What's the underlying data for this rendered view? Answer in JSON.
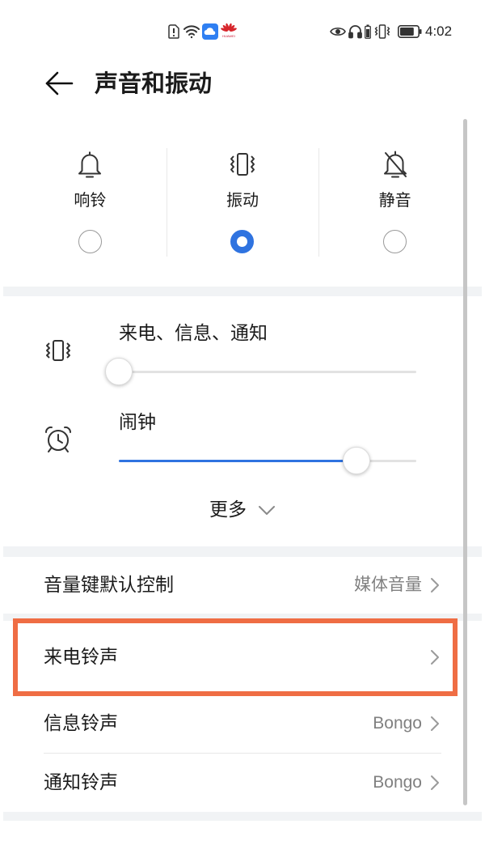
{
  "status_bar": {
    "time": "4:02",
    "logo_text": "HUAWEI",
    "left_icons": [
      "sim-alert-icon",
      "wifi-icon",
      "cloud-icon",
      "huawei-logo"
    ],
    "right_icons": [
      "eye-icon",
      "headphones-icon",
      "headphone-battery-icon",
      "vibrate-icon",
      "battery-icon"
    ],
    "battery_level": 0.8
  },
  "header": {
    "back_icon": "back-arrow-icon",
    "title": "声音和振动"
  },
  "modes": {
    "items": [
      {
        "label": "响铃",
        "icon": "bell-icon",
        "selected": false
      },
      {
        "label": "振动",
        "icon": "vibrate-icon",
        "selected": true
      },
      {
        "label": "静音",
        "icon": "bell-off-icon",
        "selected": false
      }
    ]
  },
  "volume": {
    "items": [
      {
        "label": "来电、信息、通知",
        "icon": "vibrate-icon",
        "level": 0.0
      },
      {
        "label": "闹钟",
        "icon": "alarm-clock-icon",
        "level": 0.8
      }
    ],
    "more_label": "更多",
    "more_icon": "chevron-down-icon"
  },
  "settings": {
    "rows": [
      {
        "label": "音量键默认控制",
        "value": "媒体音量",
        "icon": "chevron-right-icon",
        "highlighted": false
      },
      {
        "label": "来电铃声",
        "value": "",
        "icon": "chevron-right-icon",
        "highlighted": true
      },
      {
        "label": "信息铃声",
        "value": "Bongo",
        "icon": "chevron-right-icon",
        "highlighted": false
      },
      {
        "label": "通知铃声",
        "value": "Bongo",
        "icon": "chevron-right-icon",
        "highlighted": false
      }
    ]
  },
  "colors": {
    "accent": "#2f73e0",
    "highlight": "#ef6d44",
    "band": "#f1f3f5",
    "text": "#1b1b1b",
    "muted": "#808080"
  }
}
